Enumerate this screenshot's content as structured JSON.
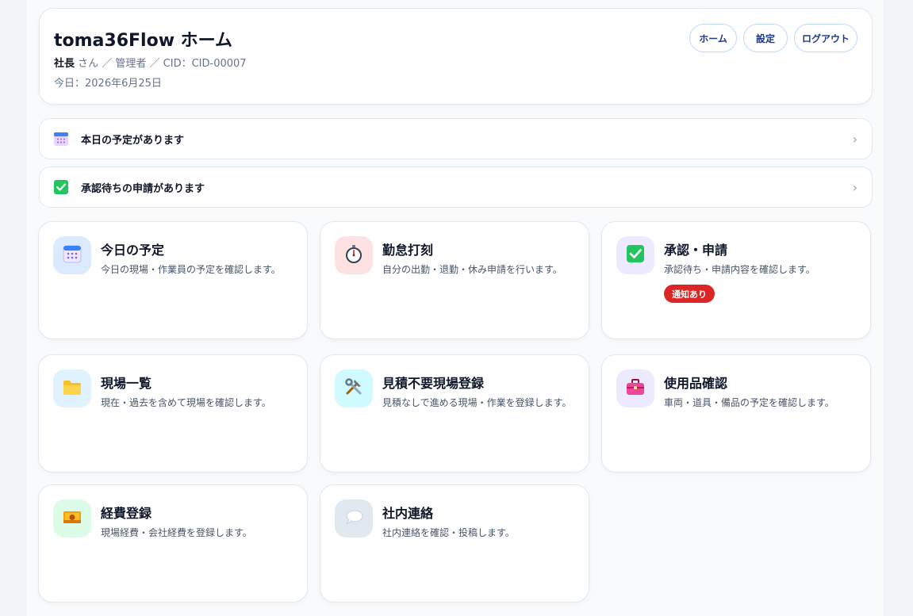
{
  "header": {
    "title": "toma36Flow ホーム",
    "user_name": "社長",
    "user_suffix": " さん ／ 管理者 ／ CID：CID-00007",
    "date": "今日：2026年6月25日",
    "nav": {
      "home": "ホーム",
      "settings": "設定",
      "logout": "ログアウト"
    }
  },
  "alerts": [
    {
      "label": "本日の予定があります",
      "icon": "calendar-icon"
    },
    {
      "label": "承認待ちの申請があります",
      "icon": "check-box-icon"
    }
  ],
  "chevron": "›",
  "cards": [
    {
      "title": "今日の予定",
      "desc": "今日の現場・作業員の予定を確認します。",
      "icon": "calendar-icon",
      "bg": "#dbeafe"
    },
    {
      "title": "勤怠打刻",
      "desc": "自分の出勤・退勤・休み申請を行います。",
      "icon": "stopwatch-icon",
      "bg": "#fee2e2"
    },
    {
      "title": "承認・申請",
      "desc": "承認待ち・申請内容を確認します。",
      "icon": "check-box-icon",
      "bg": "#ede9fe",
      "badge": "通知あり"
    },
    {
      "title": "現場一覧",
      "desc": "現在・過去を含めて現場を確認します。",
      "icon": "folder-icon",
      "bg": "#e0f2fe"
    },
    {
      "title": "見積不要現場登録",
      "desc": "見積なしで進める現場・作業を登録します。",
      "icon": "tools-icon",
      "bg": "#cffafe"
    },
    {
      "title": "使用品確認",
      "desc": "車両・道具・備品の予定を確認します。",
      "icon": "toolbox-icon",
      "bg": "#ede9fe"
    },
    {
      "title": "経費登録",
      "desc": "現場経費・会社経費を登録します。",
      "icon": "money-icon",
      "bg": "#dcfce7"
    },
    {
      "title": "社内連絡",
      "desc": "社内連絡を確認・投稿します。",
      "icon": "speech-bubble-icon",
      "bg": "#e2e8f0"
    }
  ]
}
